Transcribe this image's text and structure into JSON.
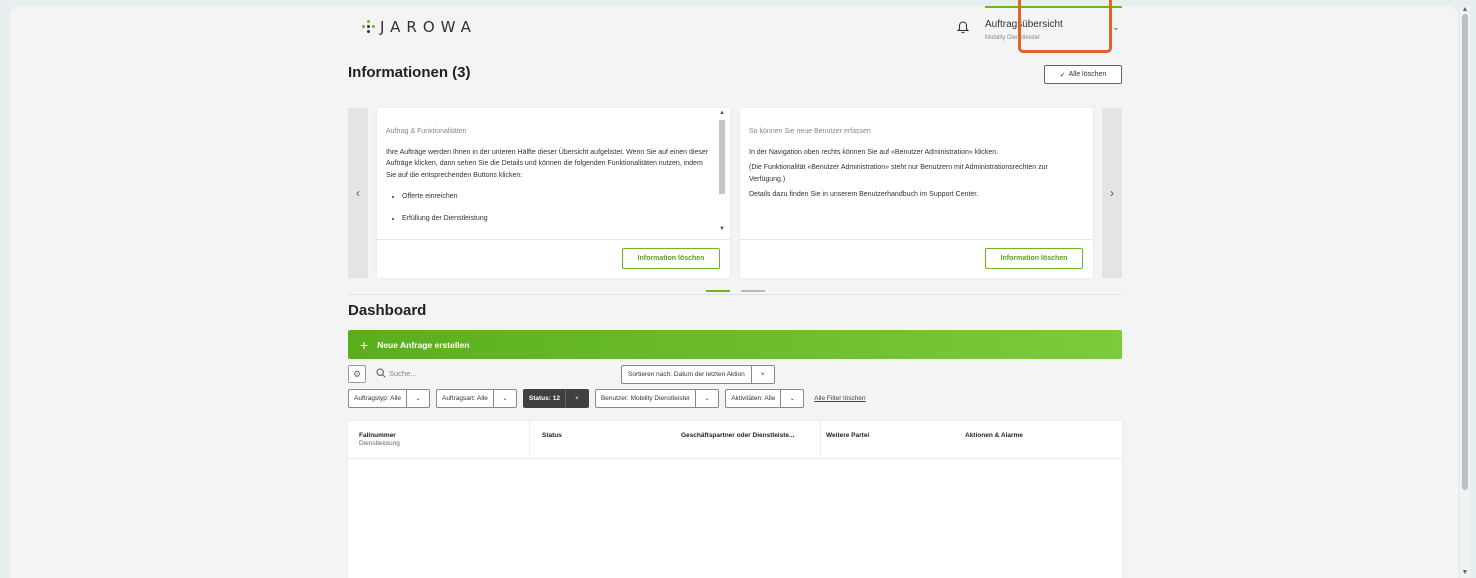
{
  "header": {
    "logo_text": "JAROWA",
    "profile_name": "Auftragsübersicht",
    "profile_role": "Mobility Dienstleister"
  },
  "info": {
    "title": "Informationen (3)",
    "clear_all_label": "Alle löschen",
    "cards": [
      {
        "subject": "Auftrag & Funktionalitäten",
        "paragraphs": [
          "Ihre Aufträge werden Ihnen in der unteren Hälfte dieser Übersicht aufgelistet. Wenn Sie auf einen dieser Aufträge klicken, dann sehen Sie die Details und können die folgenden Funktionalitäten nutzen, indem Sie auf die entsprechenden Buttons klicken:"
        ],
        "bullets": [
          "Offerte einreichen",
          "Erfüllung der Dienstleistung"
        ],
        "delete_label": "Information löschen"
      },
      {
        "subject": "So können Sie neue Benutzer erfassen",
        "paragraphs": [
          "In der Navigation oben rechts können Sie auf «Benutzer Administration» klicken.",
          "(Die Funktionalität «Benutzer Administration» steht nur Benutzern mit Administrationsrechten zur Verfügung.)",
          "Details dazu finden Sie in unserem Benutzerhandbuch im Support Center."
        ],
        "delete_label": "Information löschen"
      }
    ]
  },
  "dashboard": {
    "title": "Dashboard",
    "new_request_label": "Neue Anfrage erstellen",
    "search_placeholder": "Suche...",
    "sort_label": "Sortieren nach: Datum der letzten Aktion",
    "filters": {
      "auftragstyp": "Auftragstyp: Alle",
      "auftragsart": "Auftragsart: Alle",
      "status": "Status: 12",
      "benutzer": "Benutzer: Mobility Dienstleister",
      "aktivitaeten": "Aktivitäten: Alle",
      "clear_all": "Alle Filter löschen"
    },
    "table": {
      "columns": [
        {
          "label": "Fallnummer",
          "sub": "Dienstleistung"
        },
        {
          "label": "Status"
        },
        {
          "label": "Geschäftspartner oder Dienstleiste..."
        },
        {
          "label": "Weitere Partei"
        },
        {
          "label": "Aktionen & Alarme"
        }
      ]
    }
  },
  "colors": {
    "accent": "#6ab820",
    "highlight": "#e2602a",
    "dark_chip": "#404040"
  }
}
